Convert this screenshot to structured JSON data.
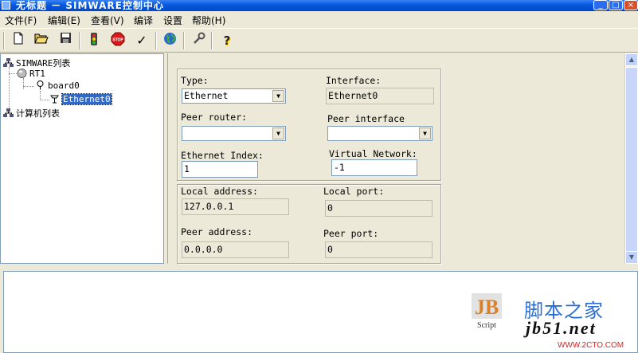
{
  "window": {
    "title": "无标题 － SIMWARE控制中心",
    "controls": {
      "minimize": "_",
      "maximize": "□",
      "close": "×"
    }
  },
  "menu": [
    {
      "label": "文件(F)"
    },
    {
      "label": "编辑(E)"
    },
    {
      "label": "查看(V)"
    },
    {
      "label": "编译"
    },
    {
      "label": "设置"
    },
    {
      "label": "帮助(H)"
    }
  ],
  "toolbar": {
    "buttons": [
      {
        "icon": "new-file-icon"
      },
      {
        "icon": "open-folder-icon"
      },
      {
        "icon": "save-disk-icon"
      },
      {
        "icon": "traffic-light-icon"
      },
      {
        "icon": "stop-sign-icon"
      },
      {
        "icon": "checkmark-icon"
      },
      {
        "icon": "globe-icon"
      },
      {
        "icon": "wrench-icon"
      },
      {
        "icon": "help-question-icon"
      }
    ],
    "stop_text": "STOP",
    "check_glyph": "✓",
    "help_glyph": "?"
  },
  "tree": {
    "root": "SIMWARE列表",
    "router": "RT1",
    "board": "board0",
    "interface": "Ethernet0",
    "computers": "计算机列表"
  },
  "form": {
    "type_label": "Type:",
    "type_value": "Ethernet",
    "interface_label": "Interface:",
    "interface_value": "Ethernet0",
    "peer_router_label": "Peer router:",
    "peer_router_value": "",
    "peer_interface_label": "Peer interface",
    "peer_interface_value": "",
    "eth_index_label": "Ethernet Index:",
    "eth_index_value": "1",
    "virtual_network_label": "Virtual Network:",
    "virtual_network_value": "-1",
    "local_address_label": "Local address:",
    "local_address_value": "127.0.0.1",
    "local_port_label": "Local port:",
    "local_port_value": "0",
    "peer_address_label": "Peer address:",
    "peer_address_value": "0.0.0.0",
    "peer_port_label": "Peer port:",
    "peer_port_value": "0"
  },
  "watermark": {
    "brand_cn": "脚本之家",
    "site": "jb51.net",
    "logo_caption": "Script",
    "logo_letters": "JB",
    "corner": "WWW.2CTO.COM"
  },
  "colors": {
    "titlebar": "#0a5be0",
    "selection": "#316ac5",
    "watermark_blue": "#2b6fd6",
    "watermark_orange": "#d9822b"
  }
}
